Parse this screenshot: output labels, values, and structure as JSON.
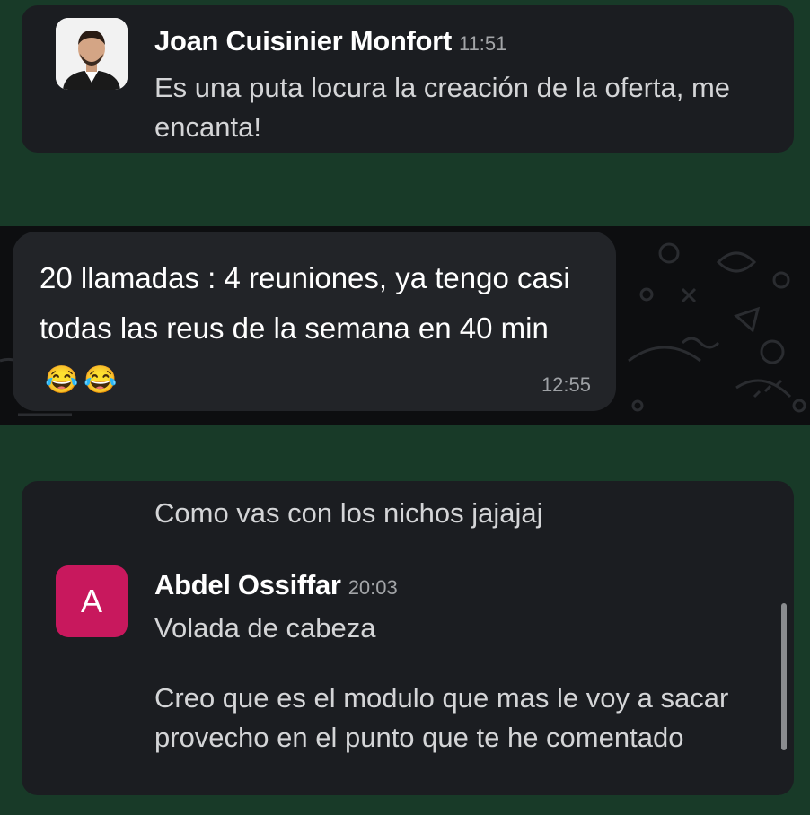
{
  "messages": [
    {
      "author": "Joan Cuisinier Monfort",
      "time": "11:51",
      "text": "Es una puta locura la creación de la oferta, me encanta!"
    },
    {
      "text": "20 llamadas : 4 reuniones, ya tengo casi todas las reus de la semana en 40 min",
      "emojis": [
        "😂",
        "😂"
      ],
      "time": "12:55"
    },
    {
      "quoted_text": "Como vas con los nichos jajajaj",
      "author": "Abdel Ossiffar",
      "avatar_letter": "A",
      "time": "20:03",
      "text_1": "Volada de cabeza",
      "text_2": "Creo que es el modulo que mas le voy a sacar provecho en el punto que te he comentado"
    }
  ],
  "colors": {
    "background": "#183a28",
    "card": "#1b1d21",
    "bubble": "#222428",
    "avatar_abdel": "#c8185d"
  }
}
